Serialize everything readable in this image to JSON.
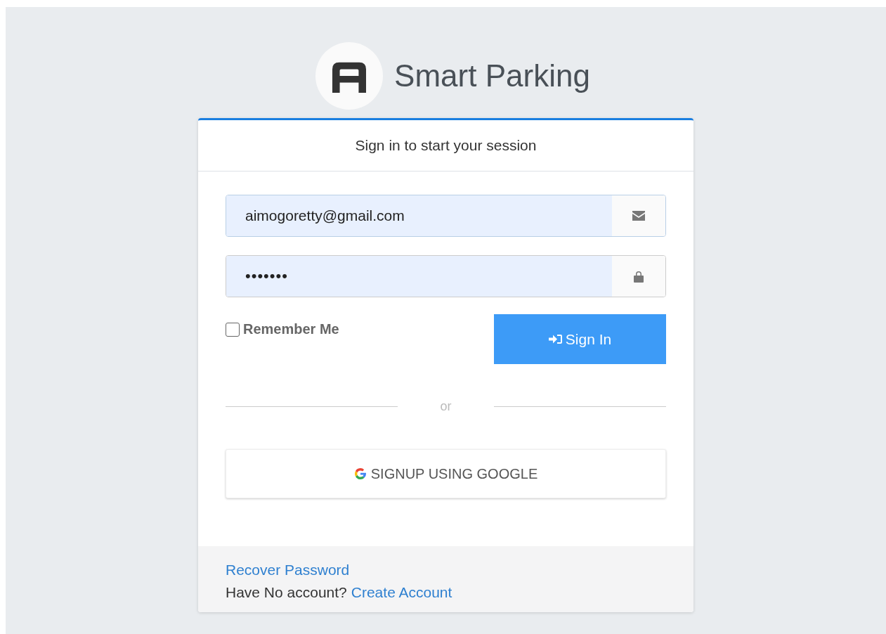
{
  "brand": {
    "title": "Smart Parking"
  },
  "card": {
    "header": "Sign in to start your session",
    "email": {
      "value": "aimogoretty@gmail.com"
    },
    "password": {
      "value": "•••••••"
    },
    "remember": {
      "label": "Remember Me",
      "checked": false
    },
    "sign_in_button": "Sign In",
    "divider": "or",
    "google_button": "SIGNUP USING GOOGLE",
    "footer": {
      "recover_link": "Recover Password",
      "prompt": "Have No account?",
      "create_link": "Create Account"
    }
  }
}
